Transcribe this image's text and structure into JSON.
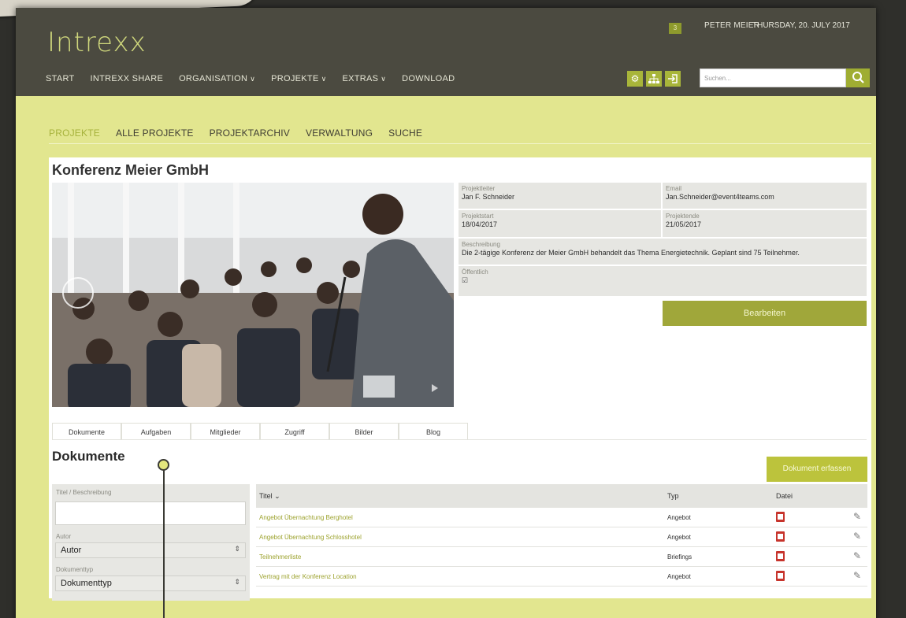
{
  "app": {
    "logo": "Intrexx",
    "notification_count": "3",
    "user_name": "PETER MEIER",
    "date": "THURSDAY, 20. JULY 2017"
  },
  "nav": {
    "items": [
      {
        "label": "START",
        "dropdown": false
      },
      {
        "label": "INTREXX SHARE",
        "dropdown": false
      },
      {
        "label": "ORGANISATION",
        "dropdown": true
      },
      {
        "label": "PROJEKTE",
        "dropdown": true
      },
      {
        "label": "EXTRAS",
        "dropdown": true
      },
      {
        "label": "DOWNLOAD",
        "dropdown": false
      }
    ],
    "search_placeholder": "Suchen...",
    "icons": [
      "gear-icon",
      "sitemap-icon",
      "logout-icon",
      "search-icon"
    ]
  },
  "subnav": {
    "items": [
      "PROJEKTE",
      "ALLE PROJEKTE",
      "PROJEKTARCHIV",
      "VERWALTUNG",
      "SUCHE"
    ],
    "active": "PROJEKTE"
  },
  "project": {
    "title": "Konferenz Meier GmbH",
    "leader_label": "Projektleiter",
    "leader": "Jan F. Schneider",
    "email_label": "Email",
    "email": "Jan.Schneider@event4teams.com",
    "start_label": "Projektstart",
    "start": "18/04/2017",
    "end_label": "Projektende",
    "end": "21/05/2017",
    "description_label": "Beschreibung",
    "description": "Die 2-tägige Konferenz der Meier GmbH behandelt das Thema Energietechnik. Geplant sind 75 Teilnehmer.",
    "public_label": "Öffentlich",
    "public_checked": true,
    "edit_button": "Bearbeiten"
  },
  "tabs": [
    "Dokumente",
    "Aufgaben",
    "Mitglieder",
    "Zugriff",
    "Bilder",
    "Blog"
  ],
  "documents": {
    "title": "Dokumente",
    "new_button": "Dokument erfassen",
    "filter": {
      "title_label": "Titel / Beschreibung",
      "author_label": "Autor",
      "author_value": "Autor",
      "doctype_label": "Dokumenttyp",
      "doctype_value": "Dokumenttyp"
    },
    "columns": [
      "Titel ⌄",
      "Typ",
      "Datei"
    ],
    "rows": [
      {
        "title": "Angebot Übernachtung Berghotel",
        "type": "Angebot"
      },
      {
        "title": "Angebot Übernachtung Schlosshotel",
        "type": "Angebot"
      },
      {
        "title": "Teilnehmerliste",
        "type": "Briefings"
      },
      {
        "title": "Vertrag mit der Konferenz Location",
        "type": "Angebot"
      }
    ]
  },
  "colors": {
    "header_bg": "#4b4a40",
    "page_bg": "#e2e68f",
    "accent": "#a0a73a",
    "link": "#9da32f"
  }
}
